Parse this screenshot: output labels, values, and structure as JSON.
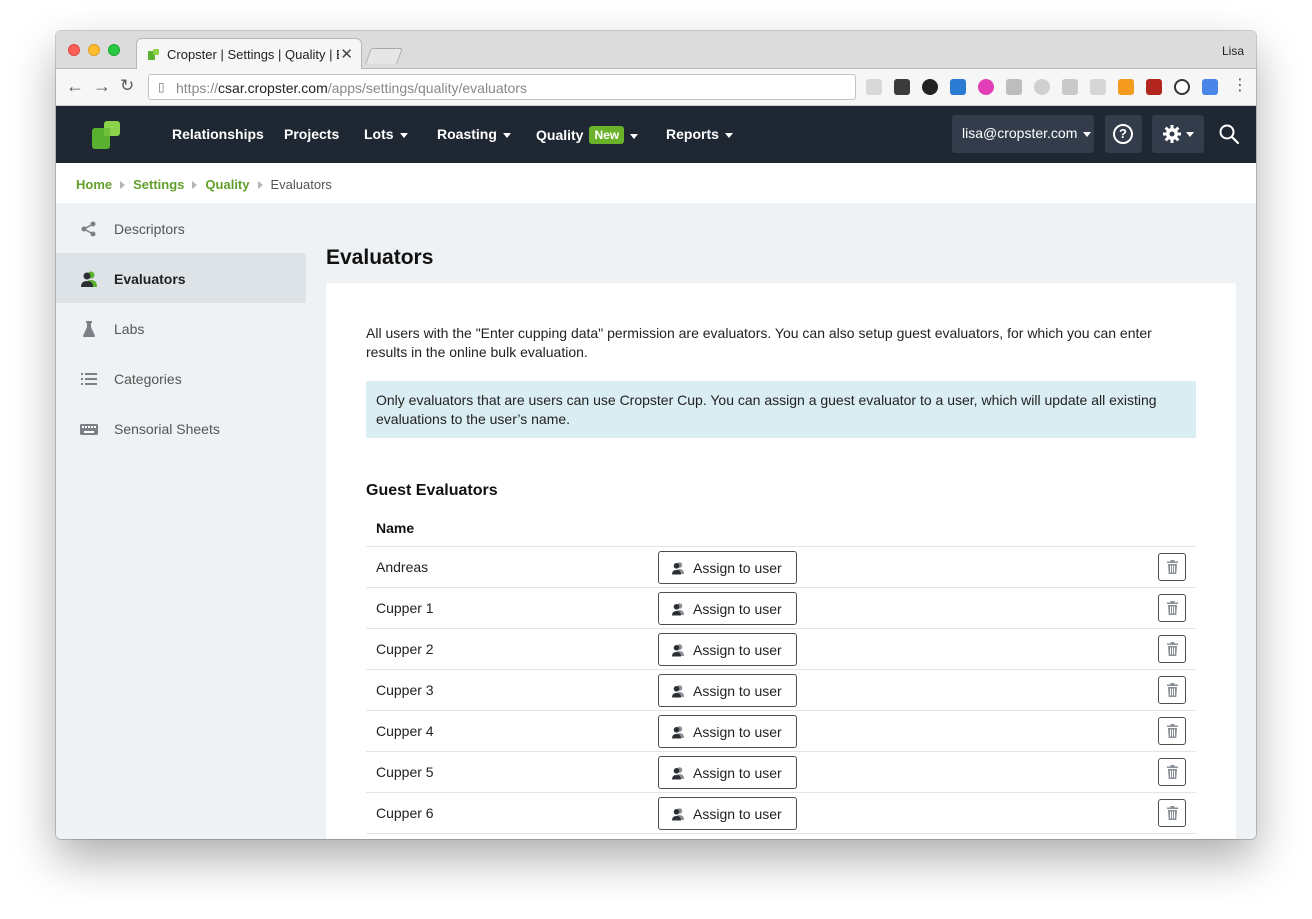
{
  "browser": {
    "tab_title": "Cropster | Settings | Quality | E",
    "profile_name": "Lisa",
    "url_scheme": "https://",
    "url_host": "csar.cropster.com",
    "url_path": "/apps/settings/quality/evaluators"
  },
  "nav": {
    "items": [
      {
        "label": "Relationships",
        "dropdown": false
      },
      {
        "label": "Projects",
        "dropdown": false
      },
      {
        "label": "Lots",
        "dropdown": true
      },
      {
        "label": "Roasting",
        "dropdown": true
      },
      {
        "label": "Quality",
        "dropdown": true,
        "badge": "New"
      },
      {
        "label": "Reports",
        "dropdown": true
      }
    ],
    "user_email": "lisa@cropster.com",
    "help_label": "?"
  },
  "breadcrumb": {
    "items": [
      "Home",
      "Settings",
      "Quality"
    ],
    "current": "Evaluators"
  },
  "sidebar": {
    "items": [
      {
        "label": "Descriptors",
        "icon": "descriptors-icon",
        "active": false
      },
      {
        "label": "Evaluators",
        "icon": "users-icon",
        "active": true
      },
      {
        "label": "Labs",
        "icon": "flask-icon",
        "active": false
      },
      {
        "label": "Categories",
        "icon": "list-icon",
        "active": false
      },
      {
        "label": "Sensorial Sheets",
        "icon": "keyboard-icon",
        "active": false
      }
    ]
  },
  "main": {
    "title": "Evaluators",
    "intro": "All users with the \"Enter cupping data\" permission are evaluators. You can also setup guest evaluators, for which you can enter results in the online bulk evaluation.",
    "alert": "Only evaluators that are users can use Cropster Cup. You can assign a guest evaluator to a user, which will update all existing evaluations to the user’s name.",
    "section_title": "Guest Evaluators",
    "column_name": "Name",
    "assign_label": "Assign to user",
    "rows": [
      "Andreas",
      "Cupper 1",
      "Cupper 2",
      "Cupper 3",
      "Cupper 4",
      "Cupper 5",
      "Cupper 6"
    ]
  },
  "colors": {
    "nav_bg": "#1f2733",
    "accent_green": "#62a02b",
    "badge_green": "#69b22a",
    "alert_bg": "#d9edf3",
    "page_bg": "#eff2f4"
  }
}
